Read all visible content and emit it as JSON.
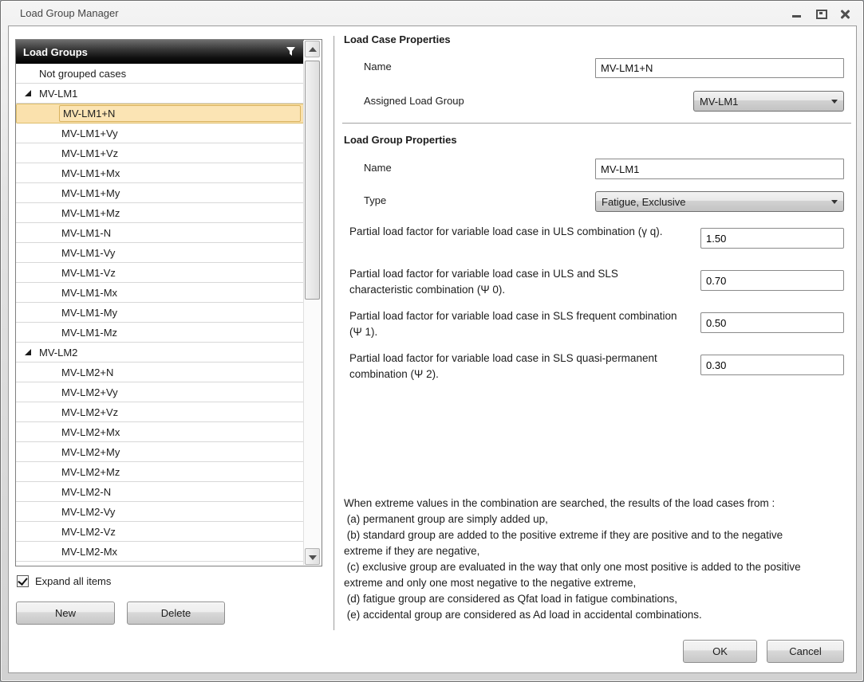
{
  "window": {
    "title": "Load Group Manager"
  },
  "left_panel": {
    "header": "Load Groups",
    "filter_icon": "funnel-icon",
    "items": [
      {
        "label": "Not grouped cases",
        "type": "root"
      },
      {
        "label": "MV-LM1",
        "type": "group",
        "expanded": true
      },
      {
        "label": "MV-LM1+N",
        "type": "child",
        "selected": true
      },
      {
        "label": "MV-LM1+Vy",
        "type": "child"
      },
      {
        "label": "MV-LM1+Vz",
        "type": "child"
      },
      {
        "label": "MV-LM1+Mx",
        "type": "child"
      },
      {
        "label": "MV-LM1+My",
        "type": "child"
      },
      {
        "label": "MV-LM1+Mz",
        "type": "child"
      },
      {
        "label": "MV-LM1-N",
        "type": "child"
      },
      {
        "label": "MV-LM1-Vy",
        "type": "child"
      },
      {
        "label": "MV-LM1-Vz",
        "type": "child"
      },
      {
        "label": "MV-LM1-Mx",
        "type": "child"
      },
      {
        "label": "MV-LM1-My",
        "type": "child"
      },
      {
        "label": "MV-LM1-Mz",
        "type": "child"
      },
      {
        "label": "MV-LM2",
        "type": "group",
        "expanded": true
      },
      {
        "label": "MV-LM2+N",
        "type": "child"
      },
      {
        "label": "MV-LM2+Vy",
        "type": "child"
      },
      {
        "label": "MV-LM2+Vz",
        "type": "child"
      },
      {
        "label": "MV-LM2+Mx",
        "type": "child"
      },
      {
        "label": "MV-LM2+My",
        "type": "child"
      },
      {
        "label": "MV-LM2+Mz",
        "type": "child"
      },
      {
        "label": "MV-LM2-N",
        "type": "child"
      },
      {
        "label": "MV-LM2-Vy",
        "type": "child"
      },
      {
        "label": "MV-LM2-Vz",
        "type": "child"
      },
      {
        "label": "MV-LM2-Mx",
        "type": "child"
      }
    ],
    "expand_checkbox_label": "Expand all items",
    "expand_checkbox_checked": true,
    "new_button": "New",
    "delete_button": "Delete"
  },
  "load_case_properties": {
    "title": "Load Case Properties",
    "name_label": "Name",
    "name_value": "MV-LM1+N",
    "assigned_group_label": "Assigned Load Group",
    "assigned_group_value": "MV-LM1"
  },
  "load_group_properties": {
    "title": "Load Group Properties",
    "name_label": "Name",
    "name_value": "MV-LM1",
    "type_label": "Type",
    "type_value": "Fatigue, Exclusive",
    "factors": [
      {
        "label": "Partial load factor for variable load case in ULS combination (γ q).",
        "value": "1.50"
      },
      {
        "label": "Partial load factor for variable load case in ULS and SLS characteristic combination (Ψ 0).",
        "value": "0.70"
      },
      {
        "label": "Partial load factor for variable load case in SLS frequent combination (Ψ 1).",
        "value": "0.50"
      },
      {
        "label": "Partial load factor for variable load case in SLS quasi-permanent combination (Ψ 2).",
        "value": "0.30"
      }
    ]
  },
  "info_text": {
    "lines": [
      "When extreme values in the combination are searched, the results of the load cases from :",
      " (a) permanent group are simply added up,",
      " (b) standard group are added to the positive extreme if they are positive and to the negative extreme if they are negative,",
      " (c) exclusive group are evaluated in the way that only one most positive is added to the positive extreme and only one most negative to the negative extreme,",
      " (d) fatigue group are considered as Qfat load in fatigue combinations,",
      " (e) accidental group are considered as Ad load in accidental combinations."
    ]
  },
  "footer": {
    "ok_button": "OK",
    "cancel_button": "Cancel"
  },
  "colors": {
    "selection_fill": "#FBE4B4",
    "selection_border": "#D9B35F",
    "list_header_dark": "#0C0C0C",
    "button_face_bottom": "#C7C7C7",
    "window_frame": "#D2D2D2"
  }
}
